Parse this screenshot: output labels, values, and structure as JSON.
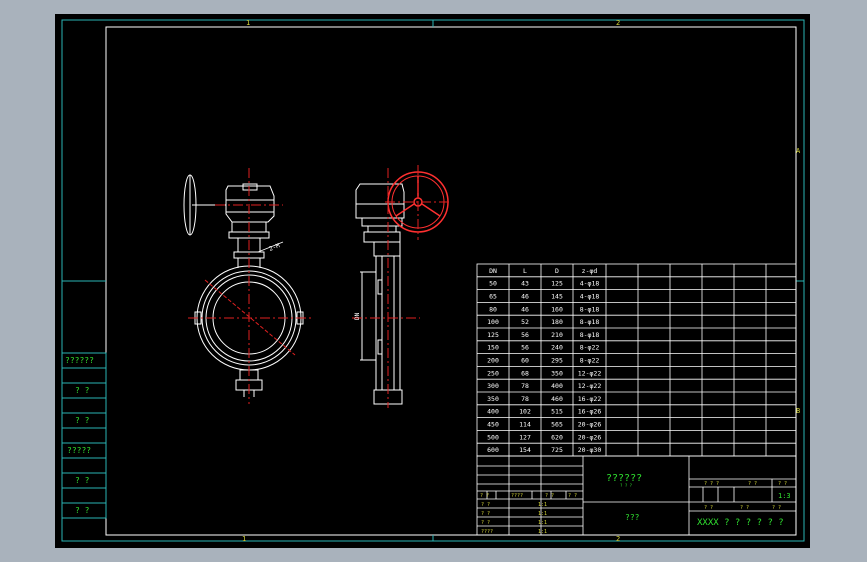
{
  "colors": {
    "background": "#a9b2bc",
    "canvas": "#000000",
    "frame": "#2ab4b4",
    "drawing": "#ffffff",
    "center_line": "#e02020",
    "gear": "#ff3030",
    "text_yellow": "#d8d83a",
    "text_green": "#30e030",
    "table_text": "#ffffff"
  },
  "zone_labels": {
    "top_1": "1",
    "top_2": "2",
    "right_a": "A",
    "right_b": "B",
    "bottom_1": "1",
    "bottom_2": "2"
  },
  "left_block": [
    "??????",
    "? ?",
    "? ?",
    "?????",
    "? ?",
    "? ?"
  ],
  "dim_labels": {
    "side_dim": "DN",
    "front_dim": "2-M"
  },
  "spec_table": {
    "headers": [
      "DN",
      "L",
      "D",
      "z-φd"
    ],
    "rows": [
      [
        "50",
        "43",
        "125",
        "4-φ18"
      ],
      [
        "65",
        "46",
        "145",
        "4-φ18"
      ],
      [
        "80",
        "46",
        "160",
        "8-φ18"
      ],
      [
        "100",
        "52",
        "180",
        "8-φ18"
      ],
      [
        "125",
        "56",
        "210",
        "8-φ18"
      ],
      [
        "150",
        "56",
        "240",
        "8-φ22"
      ],
      [
        "200",
        "60",
        "295",
        "8-φ22"
      ],
      [
        "250",
        "68",
        "350",
        "12-φ22"
      ],
      [
        "300",
        "78",
        "400",
        "12-φ22"
      ],
      [
        "350",
        "78",
        "460",
        "16-φ22"
      ],
      [
        "400",
        "102",
        "515",
        "16-φ26"
      ],
      [
        "450",
        "114",
        "565",
        "20-φ26"
      ],
      [
        "500",
        "127",
        "620",
        "20-φ26"
      ],
      [
        "600",
        "154",
        "725",
        "20-φ30"
      ]
    ]
  },
  "title_block": {
    "drawing_title": "??????",
    "drawing_sub": "? ? ?",
    "material_label": "???",
    "company": "XXXX ? ? ? ? ? ?",
    "scale": "1:3",
    "sign_row_labels": [
      "? ?",
      "????",
      "? ?",
      "? ?",
      "? ?"
    ],
    "sign_row_values": [
      "1:1",
      "1:1",
      "1:1",
      "1:1"
    ],
    "sign_extra": [
      "?????",
      "?? ?",
      "? ?"
    ],
    "sign_header": [
      "? ?",
      "????",
      "? ?",
      "????",
      "? ?"
    ],
    "right_top_labels": [
      "? ? ?",
      "? ?",
      "? ?"
    ],
    "right_bottom_labels": [
      "? ?",
      "? ?",
      "? ?"
    ]
  }
}
